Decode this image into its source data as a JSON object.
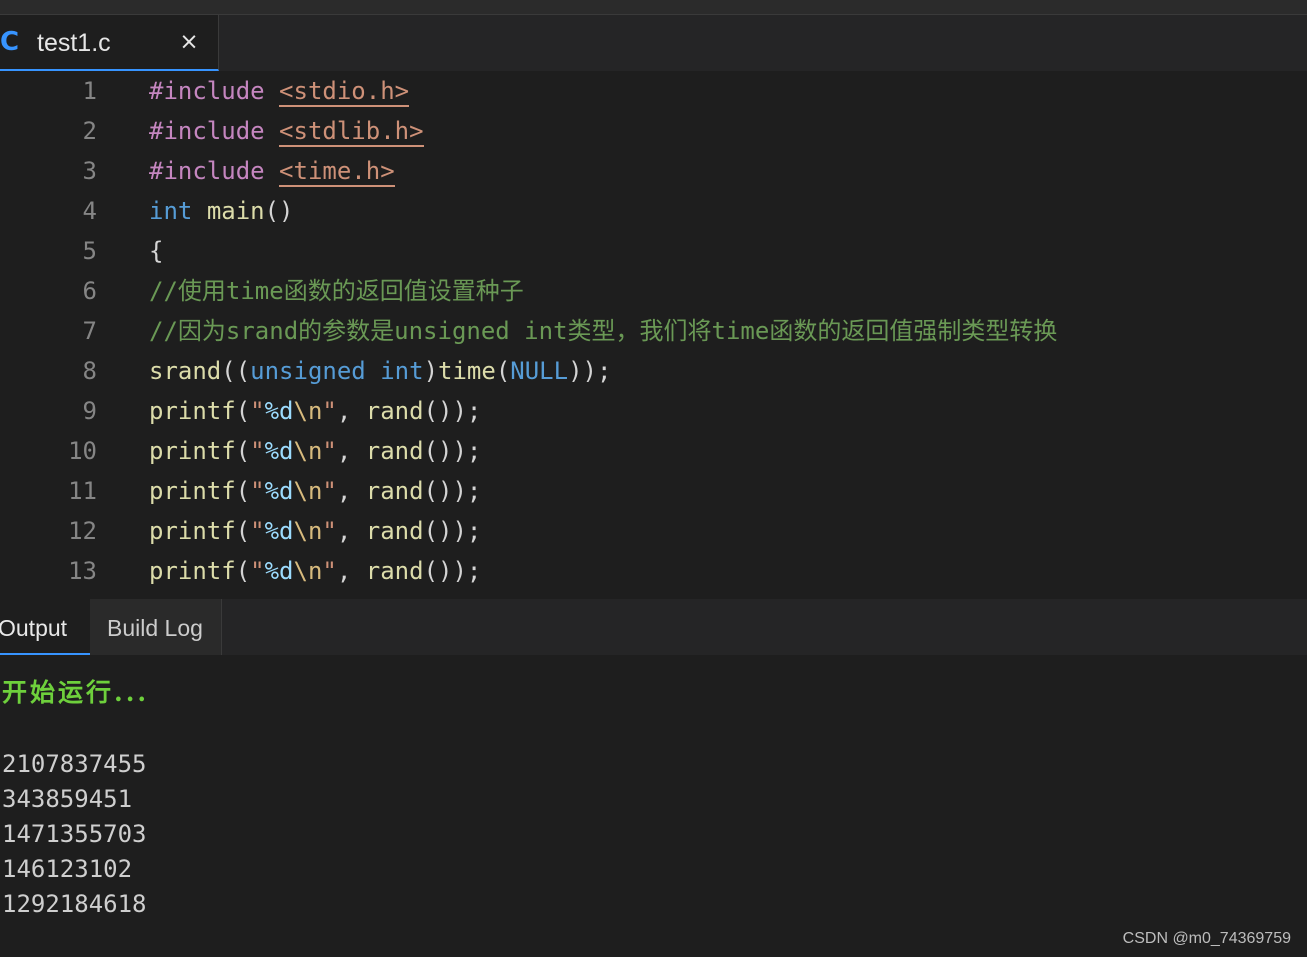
{
  "tab": {
    "icon": "C",
    "filename": "test1.c",
    "close_glyph": "×"
  },
  "editor": {
    "lines": [
      {
        "n": "1",
        "tokens": [
          {
            "t": "#include",
            "c": "kw-ctrl"
          },
          {
            "t": " "
          },
          {
            "t": "<stdio.h>",
            "c": "inc"
          }
        ]
      },
      {
        "n": "2",
        "tokens": [
          {
            "t": "#include",
            "c": "kw-ctrl"
          },
          {
            "t": " "
          },
          {
            "t": "<stdlib.h>",
            "c": "inc"
          }
        ]
      },
      {
        "n": "3",
        "tokens": [
          {
            "t": "#include",
            "c": "kw-ctrl"
          },
          {
            "t": " "
          },
          {
            "t": "<time.h>",
            "c": "inc"
          }
        ]
      },
      {
        "n": "4",
        "tokens": [
          {
            "t": "int",
            "c": "kw"
          },
          {
            "t": " "
          },
          {
            "t": "main",
            "c": "fn"
          },
          {
            "t": "()"
          }
        ]
      },
      {
        "n": "5",
        "tokens": [
          {
            "t": "{"
          }
        ]
      },
      {
        "n": "6",
        "tokens": [
          {
            "t": "//使用time函数的返回值设置种子",
            "c": "cmt"
          }
        ]
      },
      {
        "n": "7",
        "tokens": [
          {
            "t": "//因为srand的参数是unsigned int类型，我们将time函数的返回值强制类型转换",
            "c": "cmt"
          }
        ]
      },
      {
        "n": "8",
        "tokens": [
          {
            "t": "srand",
            "c": "fn"
          },
          {
            "t": "(("
          },
          {
            "t": "unsigned",
            "c": "kw"
          },
          {
            "t": " "
          },
          {
            "t": "int",
            "c": "kw"
          },
          {
            "t": ")"
          },
          {
            "t": "time",
            "c": "fn"
          },
          {
            "t": "("
          },
          {
            "t": "NULL",
            "c": "macro"
          },
          {
            "t": "));"
          }
        ]
      },
      {
        "n": "9",
        "tokens": [
          {
            "t": "printf",
            "c": "fn"
          },
          {
            "t": "("
          },
          {
            "t": "\"",
            "c": "str"
          },
          {
            "t": "%d",
            "c": "fmt"
          },
          {
            "t": "\\n",
            "c": "esc"
          },
          {
            "t": "\"",
            "c": "str"
          },
          {
            "t": ", "
          },
          {
            "t": "rand",
            "c": "fn"
          },
          {
            "t": "());"
          }
        ]
      },
      {
        "n": "10",
        "tokens": [
          {
            "t": "printf",
            "c": "fn"
          },
          {
            "t": "("
          },
          {
            "t": "\"",
            "c": "str"
          },
          {
            "t": "%d",
            "c": "fmt"
          },
          {
            "t": "\\n",
            "c": "esc"
          },
          {
            "t": "\"",
            "c": "str"
          },
          {
            "t": ", "
          },
          {
            "t": "rand",
            "c": "fn"
          },
          {
            "t": "());"
          }
        ]
      },
      {
        "n": "11",
        "tokens": [
          {
            "t": "printf",
            "c": "fn"
          },
          {
            "t": "("
          },
          {
            "t": "\"",
            "c": "str"
          },
          {
            "t": "%d",
            "c": "fmt"
          },
          {
            "t": "\\n",
            "c": "esc"
          },
          {
            "t": "\"",
            "c": "str"
          },
          {
            "t": ", "
          },
          {
            "t": "rand",
            "c": "fn"
          },
          {
            "t": "());"
          }
        ]
      },
      {
        "n": "12",
        "tokens": [
          {
            "t": "printf",
            "c": "fn"
          },
          {
            "t": "("
          },
          {
            "t": "\"",
            "c": "str"
          },
          {
            "t": "%d",
            "c": "fmt"
          },
          {
            "t": "\\n",
            "c": "esc"
          },
          {
            "t": "\"",
            "c": "str"
          },
          {
            "t": ", "
          },
          {
            "t": "rand",
            "c": "fn"
          },
          {
            "t": "());"
          }
        ]
      },
      {
        "n": "13",
        "tokens": [
          {
            "t": "printf",
            "c": "fn"
          },
          {
            "t": "("
          },
          {
            "t": "\"",
            "c": "str"
          },
          {
            "t": "%d",
            "c": "fmt"
          },
          {
            "t": "\\n",
            "c": "esc"
          },
          {
            "t": "\"",
            "c": "str"
          },
          {
            "t": ", "
          },
          {
            "t": "rand",
            "c": "fn"
          },
          {
            "t": "());"
          }
        ]
      }
    ]
  },
  "panel": {
    "tabs": [
      {
        "label": "Output"
      },
      {
        "label": "Build Log"
      }
    ]
  },
  "output": {
    "start_message": "开始运行...",
    "numbers": [
      "2107837455",
      "343859451",
      "1471355703",
      "146123102",
      "1292184618"
    ]
  },
  "watermark": "CSDN @m0_74369759",
  "colors": {
    "accent": "#3794ff",
    "background": "#1e1e1e",
    "start_message": "#6ed03c",
    "comment": "#6a9955",
    "keyword": "#569cd6",
    "function": "#dcdcaa",
    "include": "#ce9178",
    "preprocessor": "#c586c0"
  }
}
